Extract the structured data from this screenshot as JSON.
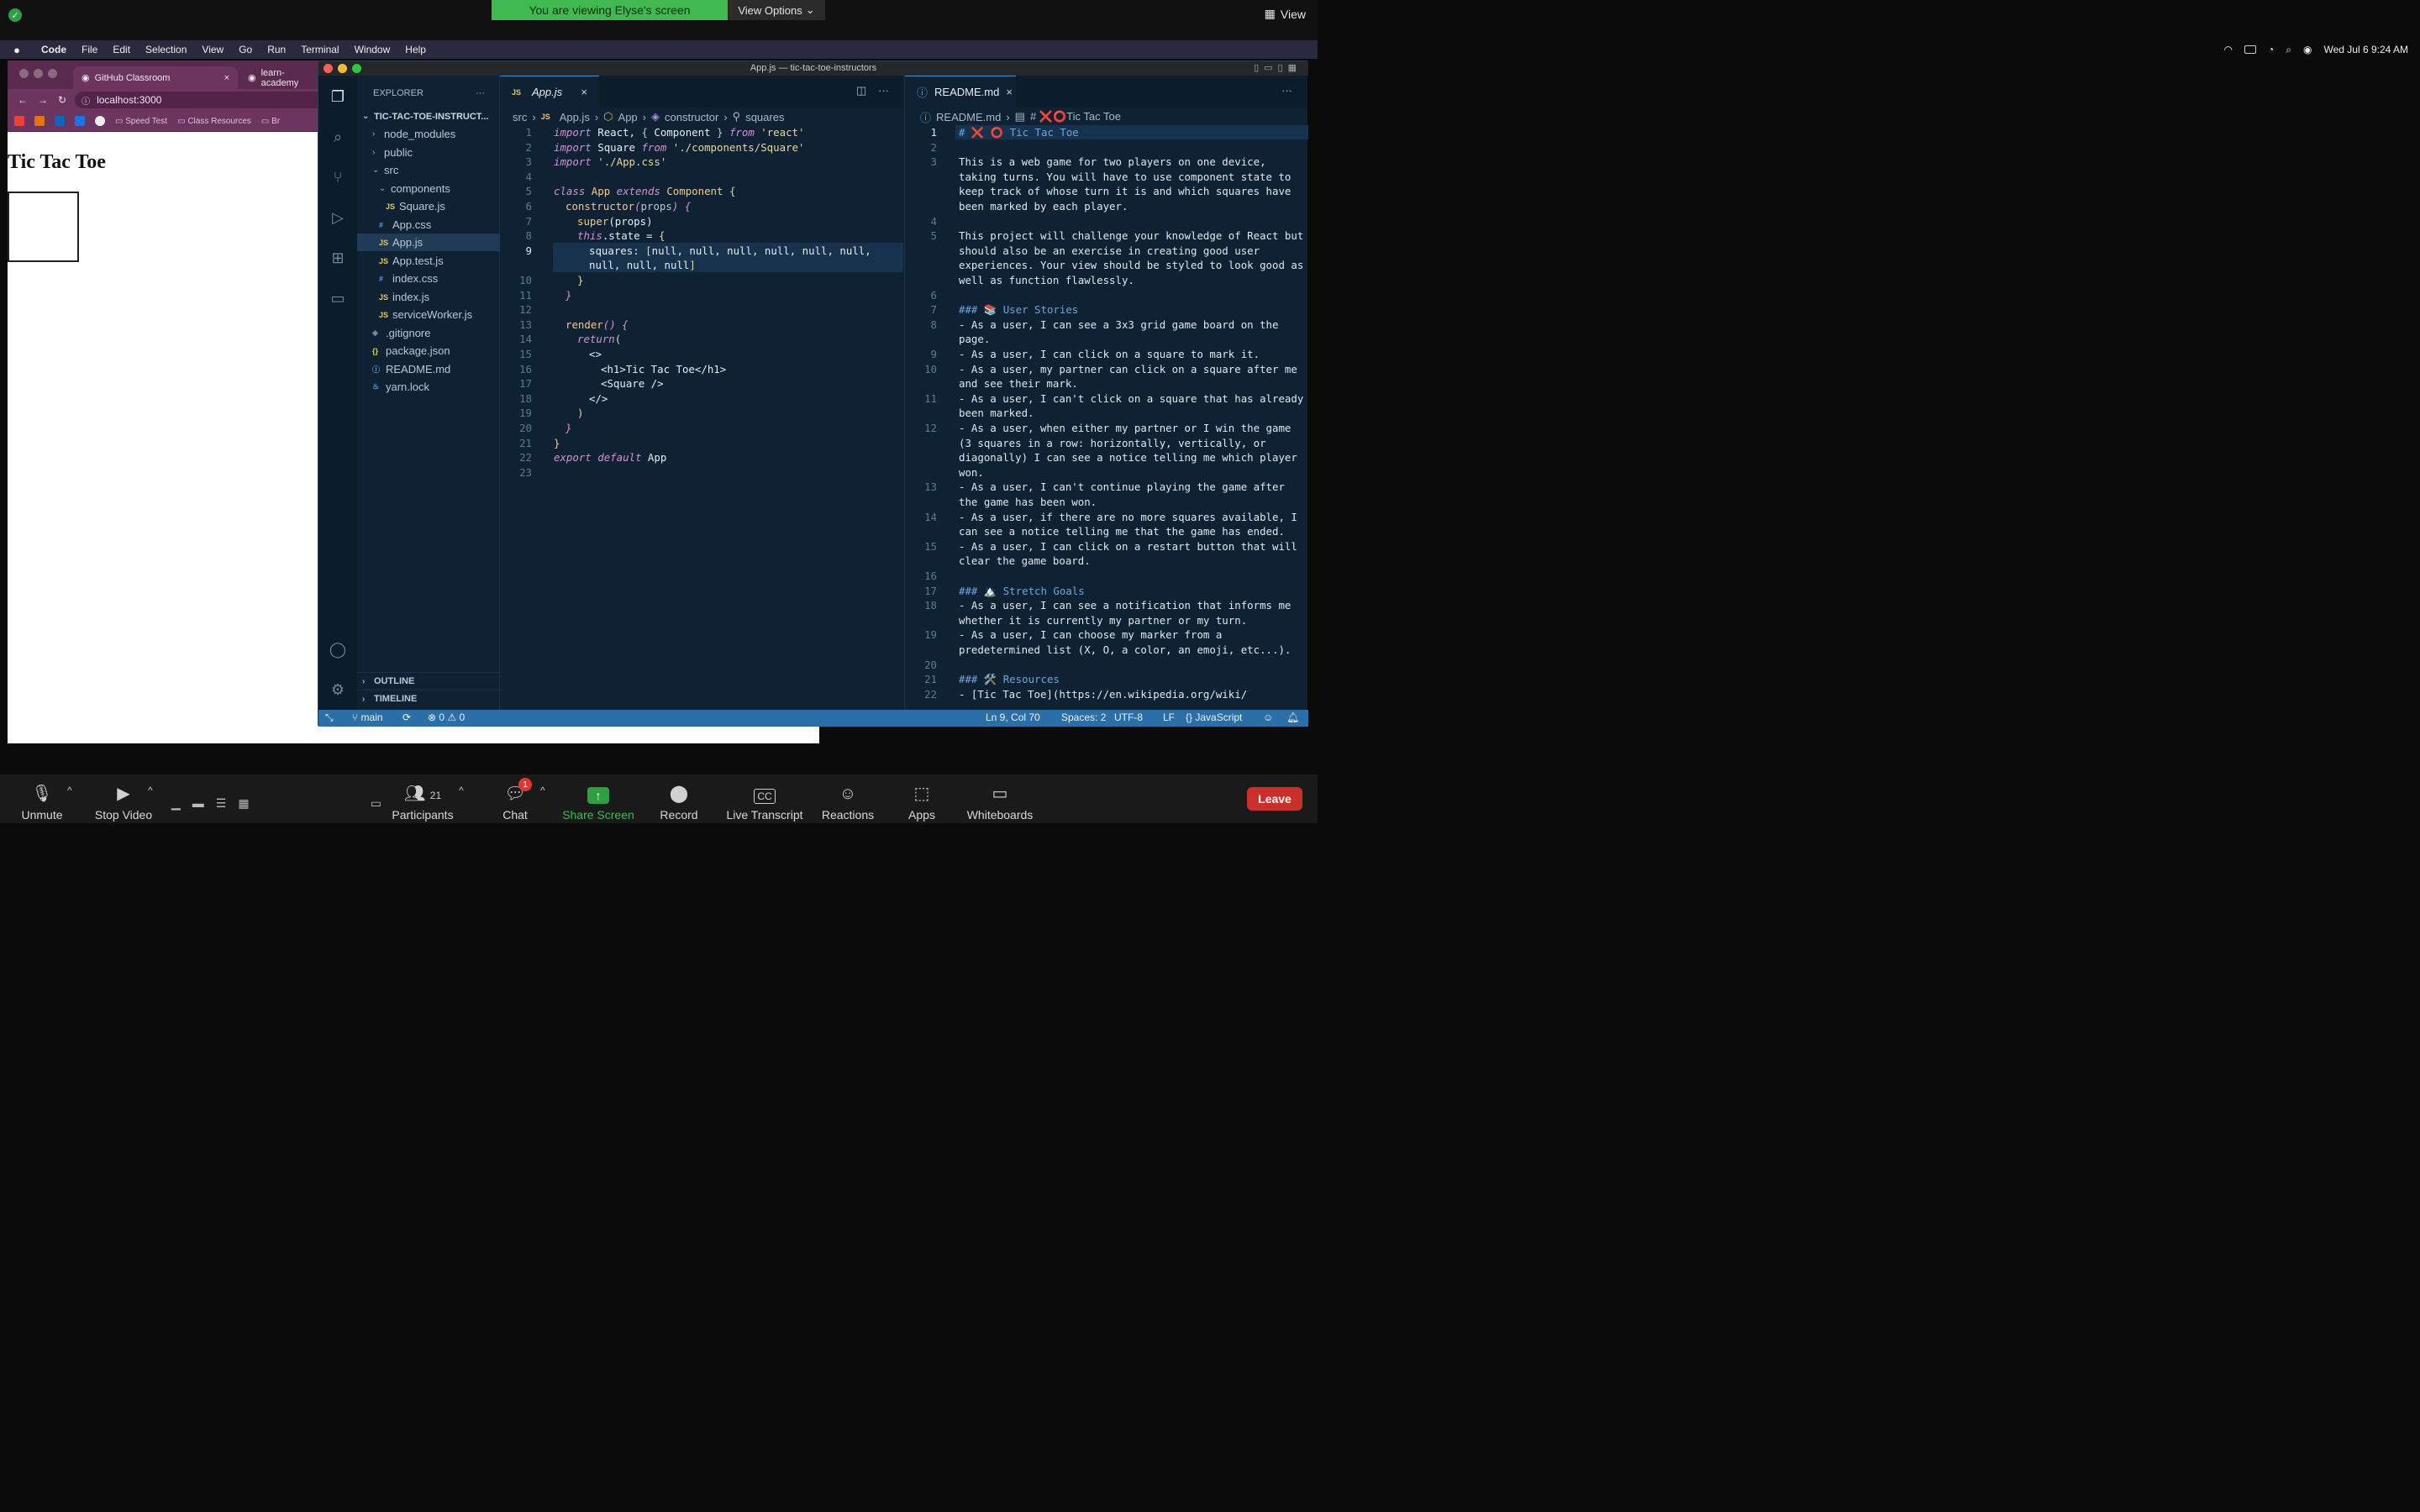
{
  "zoom_top": {
    "share_banner": "You are viewing Elyse's screen",
    "view_options": "View Options",
    "view_label": "View"
  },
  "menubar": {
    "items": [
      "Code",
      "File",
      "Edit",
      "Selection",
      "View",
      "Go",
      "Run",
      "Terminal",
      "Window",
      "Help"
    ],
    "datetime": "Wed Jul 6  9:24 AM"
  },
  "browser": {
    "tabs": [
      {
        "label": "GitHub Classroom",
        "icon": "github-icon"
      },
      {
        "label": "learn-academy",
        "icon": "github-icon"
      }
    ],
    "url": "localhost:3000",
    "bookmarks": [
      "Speed Test",
      "Class Resources",
      "Br"
    ],
    "page": {
      "heading": "Tic Tac Toe"
    }
  },
  "vscode": {
    "window_title": "App.js — tic-tac-toe-instructors",
    "explorer": {
      "title": "EXPLORER",
      "project": "TIC-TAC-TOE-INSTRUCT...",
      "items": [
        {
          "label": "node_modules",
          "kind": "folder"
        },
        {
          "label": "public",
          "kind": "folder"
        },
        {
          "label": "src",
          "kind": "folder-open"
        },
        {
          "label": "components",
          "kind": "folder-open"
        },
        {
          "label": "Square.js",
          "kind": "js"
        },
        {
          "label": "App.css",
          "kind": "css"
        },
        {
          "label": "App.js",
          "kind": "js"
        },
        {
          "label": "App.test.js",
          "kind": "js"
        },
        {
          "label": "index.css",
          "kind": "css"
        },
        {
          "label": "index.js",
          "kind": "js"
        },
        {
          "label": "serviceWorker.js",
          "kind": "js"
        },
        {
          "label": ".gitignore",
          "kind": "git"
        },
        {
          "label": "package.json",
          "kind": "json"
        },
        {
          "label": "README.md",
          "kind": "info"
        },
        {
          "label": "yarn.lock",
          "kind": "yarn"
        }
      ],
      "outline": "OUTLINE",
      "timeline": "TIMELINE"
    },
    "editor1": {
      "tab": "App.js",
      "breadcrumbs": [
        "src",
        "App.js",
        "App",
        "constructor",
        "squares"
      ],
      "line_numbers": [
        "1",
        "2",
        "3",
        "4",
        "5",
        "6",
        "7",
        "8",
        "9",
        "",
        "10",
        "11",
        "12",
        "13",
        "14",
        "15",
        "16",
        "17",
        "18",
        "19",
        "20",
        "21",
        "22",
        "23"
      ]
    },
    "editor2": {
      "tab": "README.md",
      "breadcrumbs": [
        "README.md",
        "# ❌⭕Tic Tac Toe"
      ],
      "line_numbers": [
        "1",
        "2",
        "3",
        "",
        "",
        "",
        "4",
        "5",
        "",
        "",
        "",
        "6",
        "7",
        "8",
        "",
        "9",
        "10",
        "",
        "11",
        "",
        "12",
        "",
        "",
        "",
        "13",
        "",
        "14",
        "",
        "15",
        "",
        "16",
        "17",
        "18",
        "",
        "19",
        "",
        "20",
        "21",
        "22"
      ],
      "lines": [
        "# ❌ ⭕ Tic Tac Toe",
        "",
        "This is a web game for two players on one device,",
        "taking turns. You will have to use component state to",
        "keep track of whose turn it is and which squares have",
        "been marked by each player.",
        "",
        "This project will challenge your knowledge of React but",
        "should also be an exercise in creating good user",
        "experiences. Your view should be styled to look good as",
        "well as function flawlessly.",
        "",
        "### 📚 User Stories",
        "- As a user, I can see a 3x3 grid game board on the",
        "page.",
        "- As a user, I can click on a square to mark it.",
        "- As a user, my partner can click on a square after me",
        "and see their mark.",
        "- As a user, I can't click on a square that has already",
        "been marked.",
        "- As a user, when either my partner or I win the game",
        "(3 squares in a row: horizontally, vertically, or",
        "diagonally) I can see a notice telling me which player",
        "won.",
        "- As a user, I can't continue playing the game after",
        "the game has been won.",
        "- As a user, if there are no more squares available, I",
        "can see a notice telling me that the game has ended.",
        "- As a user, I can click on a restart button that will",
        "clear the game board.",
        "",
        "### 🏔️ Stretch Goals",
        "- As a user, I can see a notification that informs me",
        "whether it is currently my partner or my turn.",
        "- As a user, I can choose my marker from a",
        "predetermined list (X, O, a color, an emoji, etc...).",
        "",
        "### 🛠️ Resources",
        "- [Tic Tac Toe](https://en.wikipedia.org/wiki/"
      ]
    },
    "status": {
      "branch": "main",
      "errors": "0",
      "warnings": "0",
      "position": "Ln 9, Col 70",
      "spaces": "Spaces: 2",
      "encoding": "UTF-8",
      "eol": "LF",
      "language": "{} JavaScript"
    }
  },
  "zoom_bar": {
    "items": [
      {
        "label": "Unmute",
        "icon": "mic-off-icon"
      },
      {
        "label": "Stop Video",
        "icon": "video-icon"
      },
      {
        "label": "Participants",
        "icon": "participants-icon",
        "count": "21"
      },
      {
        "label": "Chat",
        "icon": "chat-icon",
        "badge": "1"
      },
      {
        "label": "Share Screen",
        "icon": "share-screen-icon"
      },
      {
        "label": "Record",
        "icon": "record-icon"
      },
      {
        "label": "Live Transcript",
        "icon": "cc-icon"
      },
      {
        "label": "Reactions",
        "icon": "reactions-icon"
      },
      {
        "label": "Apps",
        "icon": "apps-icon"
      },
      {
        "label": "Whiteboards",
        "icon": "whiteboard-icon"
      }
    ],
    "leave": "Leave"
  },
  "colors": {
    "share_green": "#3fb950",
    "vscode_bg": "#0f2233",
    "status_blue": "#2a6fa8",
    "leave_red": "#c9302c"
  }
}
